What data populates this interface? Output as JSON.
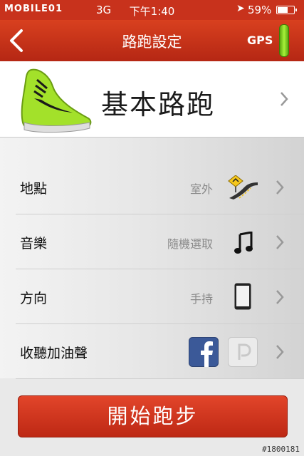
{
  "status_bar": {
    "carrier": "MOBILE01",
    "network": "3G",
    "time": "下午1:40",
    "battery": "59%",
    "battery_level": 0.59
  },
  "nav": {
    "title": "路跑設定",
    "gps_label": "GPS"
  },
  "workout": {
    "title": "基本路跑"
  },
  "settings": [
    {
      "label": "地點",
      "value": "室外",
      "icon": "road-sign-icon"
    },
    {
      "label": "音樂",
      "value": "隨機選取",
      "icon": "music-note-icon"
    },
    {
      "label": "方向",
      "value": "手持",
      "icon": "phone-icon"
    },
    {
      "label": "收聽加油聲",
      "value": "",
      "icon": "facebook-icon, path-icon"
    }
  ],
  "start_button": {
    "label": "開始跑步"
  },
  "watermark": "#1800181",
  "colors": {
    "brand_red": "#c8321c",
    "gps_green": "#8bd42a",
    "facebook_blue": "#3b5998"
  }
}
